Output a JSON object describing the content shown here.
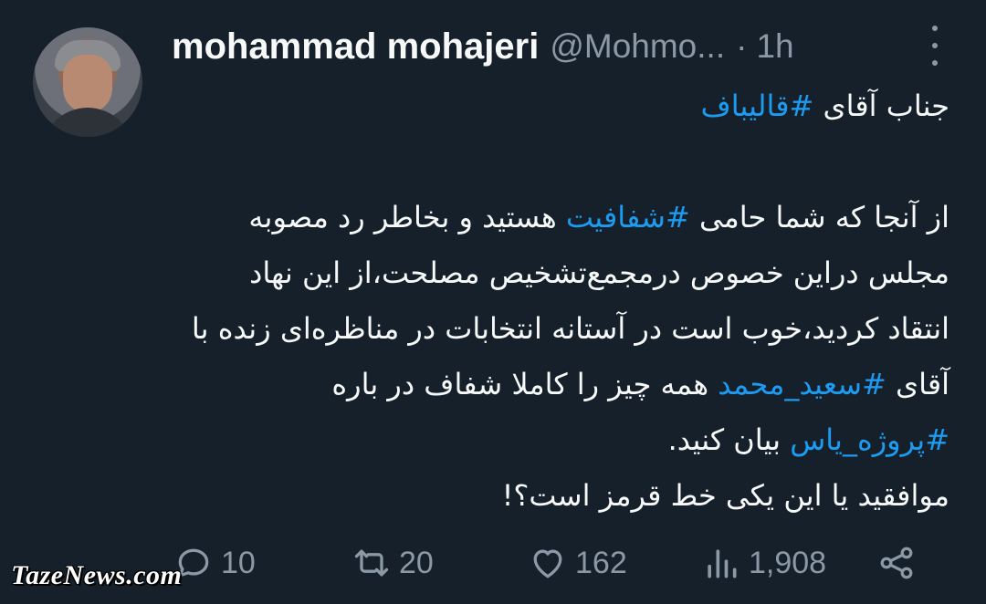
{
  "author": {
    "name": "mohammad mohajeri",
    "handle": "@Mohmo...",
    "separator": "·",
    "time": "1h"
  },
  "tweet": {
    "line1_text": "جناب آقای ",
    "line1_tag": "#قالیباف",
    "p2_a": "از آنجا که شما حامی ",
    "p2_tag1": "#شفافیت",
    "p2_b": " هستید و بخاطر رد مصوبه مجلس دراین خصوص درمجمع‌تشخیص مصلحت،از این نهاد انتقاد کردید،خوب است در آستانه انتخابات در مناظره‌ای زنده با آقای ",
    "p2_tag2": "#سعید_محمد",
    "p2_c": " همه چیز را کاملا شفاف در باره ",
    "p2_tag3": "#پروژه_یاس",
    "p2_d": " بیان کنید.",
    "p3": "موافقید یا این یکی خط قرمز است؟!"
  },
  "actions": {
    "reply_count": "10",
    "retweet_count": "20",
    "like_count": "162",
    "views_count": "1,908"
  },
  "colors": {
    "background": "#15202b",
    "text": "#f7f9f9",
    "muted": "#8b98a5",
    "hashtag": "#1d9bf0"
  },
  "icons": [
    "more-vertical-icon",
    "reply-icon",
    "retweet-icon",
    "like-icon",
    "views-icon",
    "share-icon"
  ],
  "watermark": "TazeNews.com"
}
